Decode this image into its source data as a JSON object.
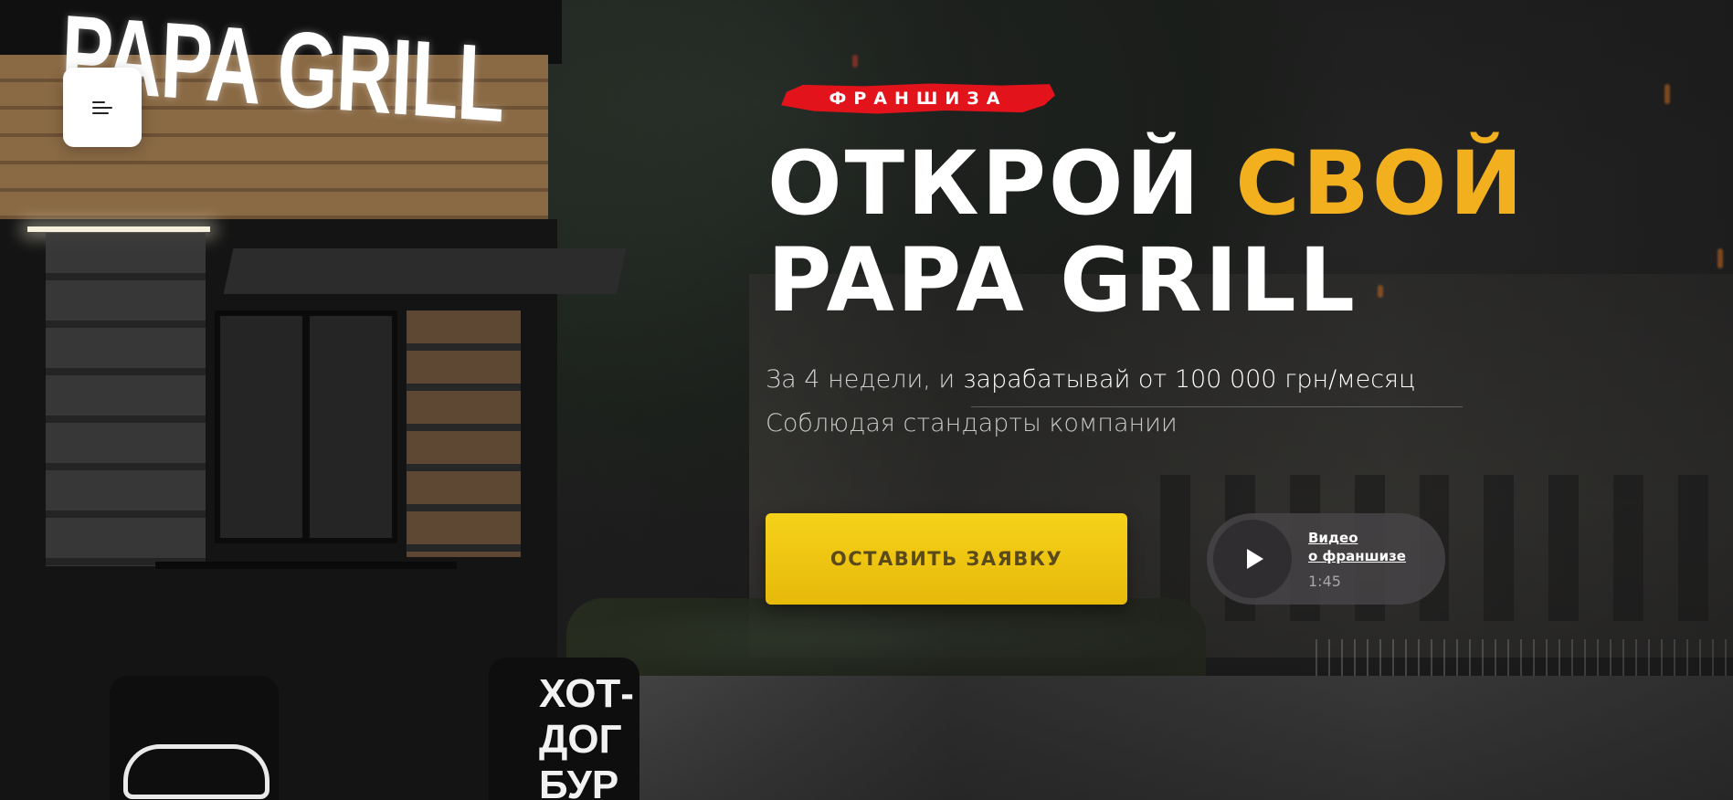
{
  "colors": {
    "accent_yellow": "#f2b01e",
    "cta_yellow": "#f5d21a",
    "badge_red": "#e3131b",
    "text_white": "#ffffff"
  },
  "kiosk": {
    "sign_text": "PAPA GRILL",
    "barrel_lines": [
      "ХОТ-",
      "ДОГ",
      "БУР"
    ]
  },
  "nav": {
    "menu_icon": "hamburger-menu-icon"
  },
  "hero": {
    "badge": "ФРАНШИЗА",
    "headline_part1": "ОТКРОЙ ",
    "headline_accent": "СВОЙ",
    "headline_line2": "PAPA GRILL",
    "subtitle_lead": "За 4 недели, и ",
    "subtitle_highlight": "зарабатывай от 100 000 грн/месяц",
    "subtitle_line2": "Соблюдая стандарты компании",
    "cta_label": "ОСТАВИТЬ ЗАЯВКУ",
    "video": {
      "title_line1": "Видео",
      "title_line2": "о франшизе",
      "duration": "1:45",
      "icon": "play-icon"
    }
  }
}
